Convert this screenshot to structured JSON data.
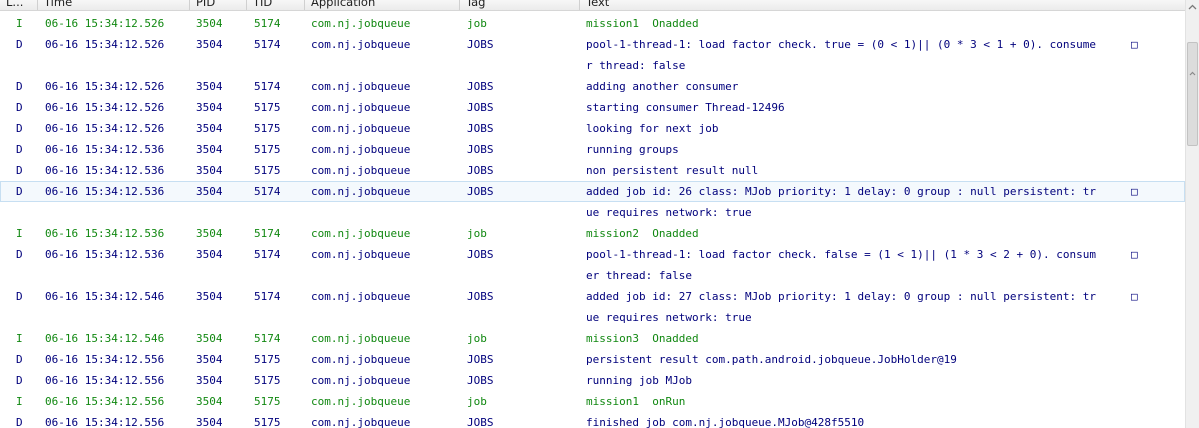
{
  "columns": {
    "level": "L...",
    "time": "Time",
    "pid": "PID",
    "tid": "TID",
    "application": "Application",
    "tag": "Tag",
    "text": "Text"
  },
  "wrap_glyph": "□",
  "colors": {
    "debug": "#00007c",
    "info": "#118811",
    "selected_row_bg": "#f4f9fd"
  },
  "rows": [
    {
      "level": "I",
      "time": "06-16 15:34:12.526",
      "pid": "3504",
      "tid": "5174",
      "app": "com.nj.jobqueue",
      "tag": "job",
      "text": "mission1  Onadded",
      "kind": "info"
    },
    {
      "level": "D",
      "time": "06-16 15:34:12.526",
      "pid": "3504",
      "tid": "5174",
      "app": "com.nj.jobqueue",
      "tag": "JOBS",
      "text": "pool-1-thread-1: load factor check. true = (0 < 1)|| (0 * 3 < 1 + 0). consume",
      "kind": "debug",
      "wrap": true
    },
    {
      "level": "",
      "time": "",
      "pid": "",
      "tid": "",
      "app": "",
      "tag": "",
      "text": "r thread: false",
      "kind": "debug"
    },
    {
      "level": "D",
      "time": "06-16 15:34:12.526",
      "pid": "3504",
      "tid": "5174",
      "app": "com.nj.jobqueue",
      "tag": "JOBS",
      "text": "adding another consumer",
      "kind": "debug"
    },
    {
      "level": "D",
      "time": "06-16 15:34:12.526",
      "pid": "3504",
      "tid": "5175",
      "app": "com.nj.jobqueue",
      "tag": "JOBS",
      "text": "starting consumer Thread-12496",
      "kind": "debug"
    },
    {
      "level": "D",
      "time": "06-16 15:34:12.526",
      "pid": "3504",
      "tid": "5175",
      "app": "com.nj.jobqueue",
      "tag": "JOBS",
      "text": "looking for next job",
      "kind": "debug"
    },
    {
      "level": "D",
      "time": "06-16 15:34:12.536",
      "pid": "3504",
      "tid": "5175",
      "app": "com.nj.jobqueue",
      "tag": "JOBS",
      "text": "running groups",
      "kind": "debug"
    },
    {
      "level": "D",
      "time": "06-16 15:34:12.536",
      "pid": "3504",
      "tid": "5175",
      "app": "com.nj.jobqueue",
      "tag": "JOBS",
      "text": "non persistent result null",
      "kind": "debug"
    },
    {
      "level": "D",
      "time": "06-16 15:34:12.536",
      "pid": "3504",
      "tid": "5174",
      "app": "com.nj.jobqueue",
      "tag": "JOBS",
      "text": "added job id: 26 class: MJob priority: 1 delay: 0 group : null persistent: tr",
      "kind": "debug",
      "wrap": true,
      "selected": true
    },
    {
      "level": "",
      "time": "",
      "pid": "",
      "tid": "",
      "app": "",
      "tag": "",
      "text": "ue requires network: true",
      "kind": "debug"
    },
    {
      "level": "I",
      "time": "06-16 15:34:12.536",
      "pid": "3504",
      "tid": "5174",
      "app": "com.nj.jobqueue",
      "tag": "job",
      "text": "mission2  Onadded",
      "kind": "info"
    },
    {
      "level": "D",
      "time": "06-16 15:34:12.536",
      "pid": "3504",
      "tid": "5174",
      "app": "com.nj.jobqueue",
      "tag": "JOBS",
      "text": "pool-1-thread-1: load factor check. false = (1 < 1)|| (1 * 3 < 2 + 0). consum",
      "kind": "debug",
      "wrap": true
    },
    {
      "level": "",
      "time": "",
      "pid": "",
      "tid": "",
      "app": "",
      "tag": "",
      "text": "er thread: false",
      "kind": "debug"
    },
    {
      "level": "D",
      "time": "06-16 15:34:12.546",
      "pid": "3504",
      "tid": "5174",
      "app": "com.nj.jobqueue",
      "tag": "JOBS",
      "text": "added job id: 27 class: MJob priority: 1 delay: 0 group : null persistent: tr",
      "kind": "debug",
      "wrap": true
    },
    {
      "level": "",
      "time": "",
      "pid": "",
      "tid": "",
      "app": "",
      "tag": "",
      "text": "ue requires network: true",
      "kind": "debug"
    },
    {
      "level": "I",
      "time": "06-16 15:34:12.546",
      "pid": "3504",
      "tid": "5174",
      "app": "com.nj.jobqueue",
      "tag": "job",
      "text": "mission3  Onadded",
      "kind": "info"
    },
    {
      "level": "D",
      "time": "06-16 15:34:12.556",
      "pid": "3504",
      "tid": "5175",
      "app": "com.nj.jobqueue",
      "tag": "JOBS",
      "text": "persistent result com.path.android.jobqueue.JobHolder@19",
      "kind": "debug"
    },
    {
      "level": "D",
      "time": "06-16 15:34:12.556",
      "pid": "3504",
      "tid": "5175",
      "app": "com.nj.jobqueue",
      "tag": "JOBS",
      "text": "running job MJob",
      "kind": "debug"
    },
    {
      "level": "I",
      "time": "06-16 15:34:12.556",
      "pid": "3504",
      "tid": "5175",
      "app": "com.nj.jobqueue",
      "tag": "job",
      "text": "mission1  onRun",
      "kind": "info"
    },
    {
      "level": "D",
      "time": "06-16 15:34:12.556",
      "pid": "3504",
      "tid": "5175",
      "app": "com.nj.jobqueue",
      "tag": "JOBS",
      "text": "finished job com.nj.jobqueue.MJob@428f5510",
      "kind": "debug"
    }
  ]
}
